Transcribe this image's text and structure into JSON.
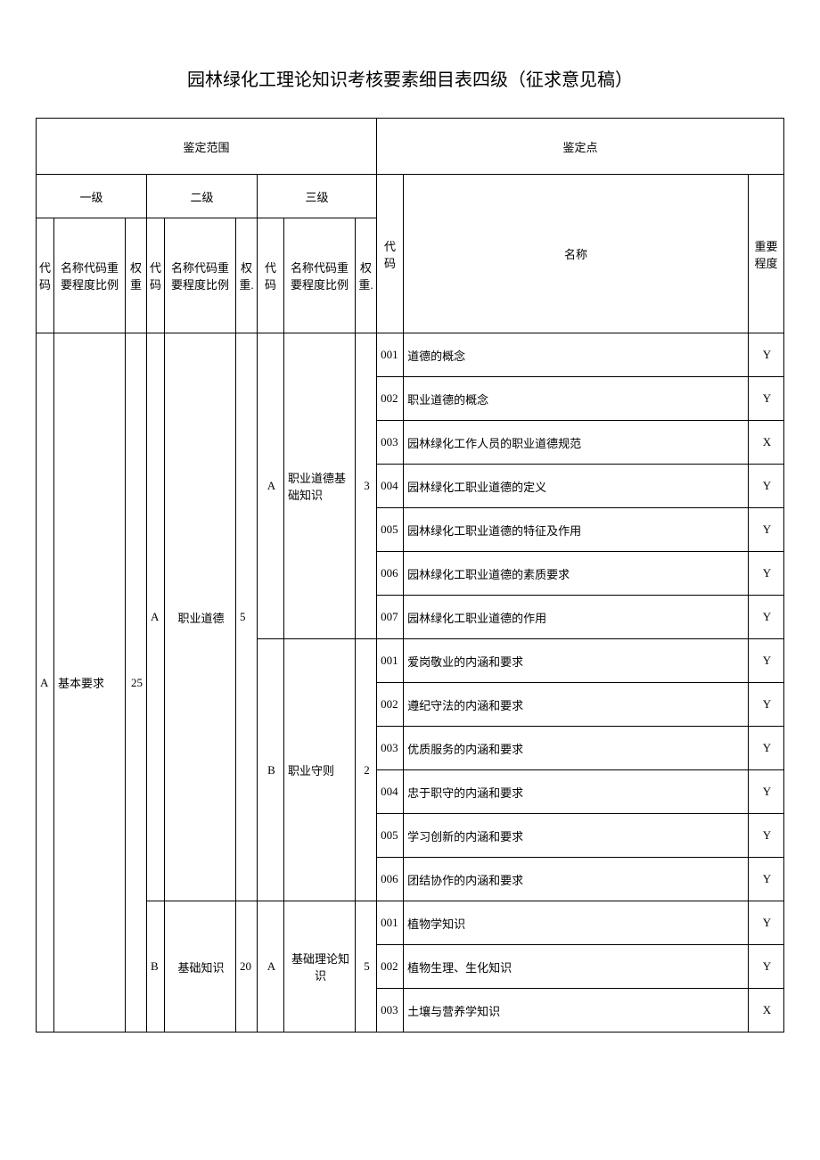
{
  "title": "园林绿化工理论知识考核要素细目表四级（征求意见稿）",
  "headers": {
    "scope": "鉴定范围",
    "point": "鉴定点",
    "l1": "一级",
    "l2": "二级",
    "l3": "三级",
    "code": "代码",
    "name_ratio": "名称代码重要程度比例",
    "weight": "权重",
    "weight_dot": "权重.",
    "pt_code": "代码",
    "pt_name": "名称",
    "pt_imp": "重要程度"
  },
  "l1": {
    "code": "A",
    "name": "基本要求",
    "weight": "25"
  },
  "l2": [
    {
      "code": "A",
      "name": "职业道德",
      "weight": "5"
    },
    {
      "code": "B",
      "name": "基础知识",
      "weight": "20"
    }
  ],
  "l3": [
    {
      "code": "A",
      "name": "职业道德基础知识",
      "weight": "3"
    },
    {
      "code": "B",
      "name": "职业守则",
      "weight": "2"
    },
    {
      "code": "A",
      "name": "基础理论知识",
      "weight": "5"
    }
  ],
  "rows": [
    {
      "code": "001",
      "name": "道德的概念",
      "imp": "Y"
    },
    {
      "code": "002",
      "name": "职业道德的概念",
      "imp": "Y"
    },
    {
      "code": "003",
      "name": "园林绿化工作人员的职业道德规范",
      "imp": "X"
    },
    {
      "code": "004",
      "name": "园林绿化工职业道德的定义",
      "imp": "Y"
    },
    {
      "code": "005",
      "name": "园林绿化工职业道德的特征及作用",
      "imp": "Y"
    },
    {
      "code": "006",
      "name": "园林绿化工职业道德的素质要求",
      "imp": "Y"
    },
    {
      "code": "007",
      "name": "园林绿化工职业道德的作用",
      "imp": "Y"
    },
    {
      "code": "001",
      "name": "爱岗敬业的内涵和要求",
      "imp": "Y"
    },
    {
      "code": "002",
      "name": "遵纪守法的内涵和要求",
      "imp": "Y"
    },
    {
      "code": "003",
      "name": "优质服务的内涵和要求",
      "imp": "Y"
    },
    {
      "code": "004",
      "name": "忠于职守的内涵和要求",
      "imp": "Y"
    },
    {
      "code": "005",
      "name": "学习创新的内涵和要求",
      "imp": "Y"
    },
    {
      "code": "006",
      "name": "团结协作的内涵和要求",
      "imp": "Y"
    },
    {
      "code": "001",
      "name": "植物学知识",
      "imp": "Y"
    },
    {
      "code": "002",
      "name": "植物生理、生化知识",
      "imp": "Y"
    },
    {
      "code": "003",
      "name": "土壤与营养学知识",
      "imp": "X"
    }
  ]
}
